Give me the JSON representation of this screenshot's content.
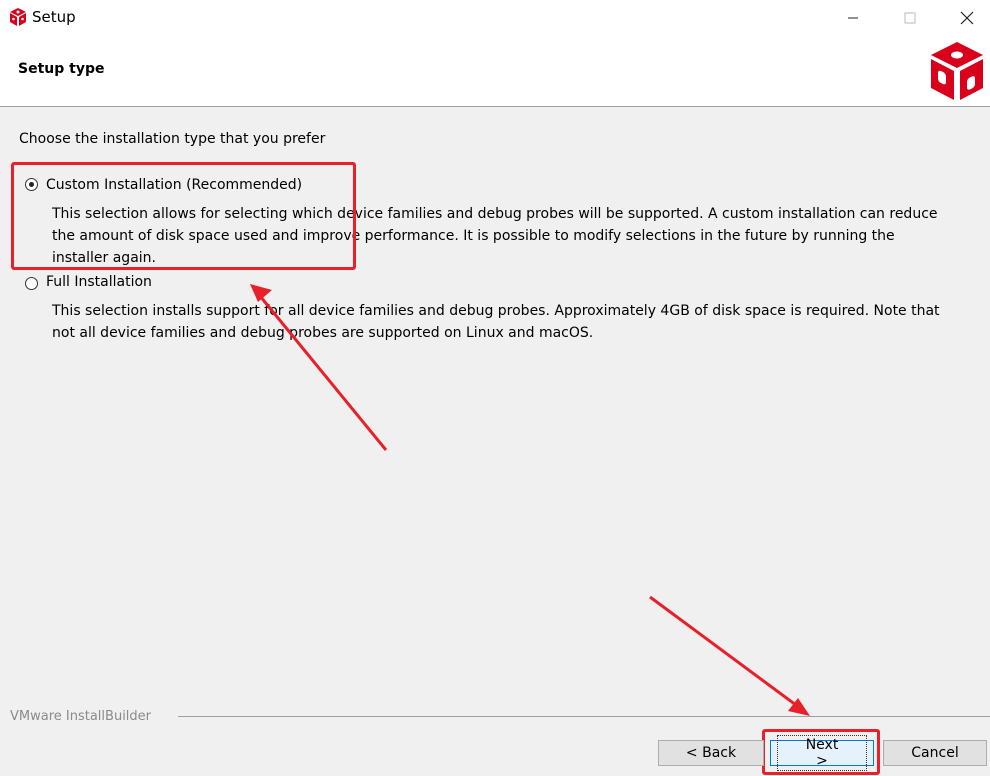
{
  "window": {
    "title": "Setup",
    "controls": {
      "minimize": "—",
      "maximize": "☐",
      "close": "✕"
    }
  },
  "header": {
    "title": "Setup type"
  },
  "prompt": "Choose the installation type that you prefer",
  "options": [
    {
      "label": "Custom Installation (Recommended)",
      "selected": true,
      "desc_lines": [
        "This selection allows for selecting which device families and debug probes will be supported.  A custom installation can reduce",
        "the amount of disk space used and improve performance.  It is possible to modify selections in the future by running the",
        "installer again."
      ]
    },
    {
      "label": "Full Installation",
      "selected": false,
      "desc_lines": [
        "This selection installs support for all device families and debug probes.  Approximately 4GB of disk space is required.  Note that",
        "not all device families and debug probes are supported on Linux and macOS."
      ]
    }
  ],
  "footer": {
    "brand": "VMware InstallBuilder",
    "back_label": "< Back",
    "next_label": "Next >",
    "cancel_label": "Cancel"
  },
  "colors": {
    "annotation": "#e8202a",
    "logo": "#d9001b"
  }
}
